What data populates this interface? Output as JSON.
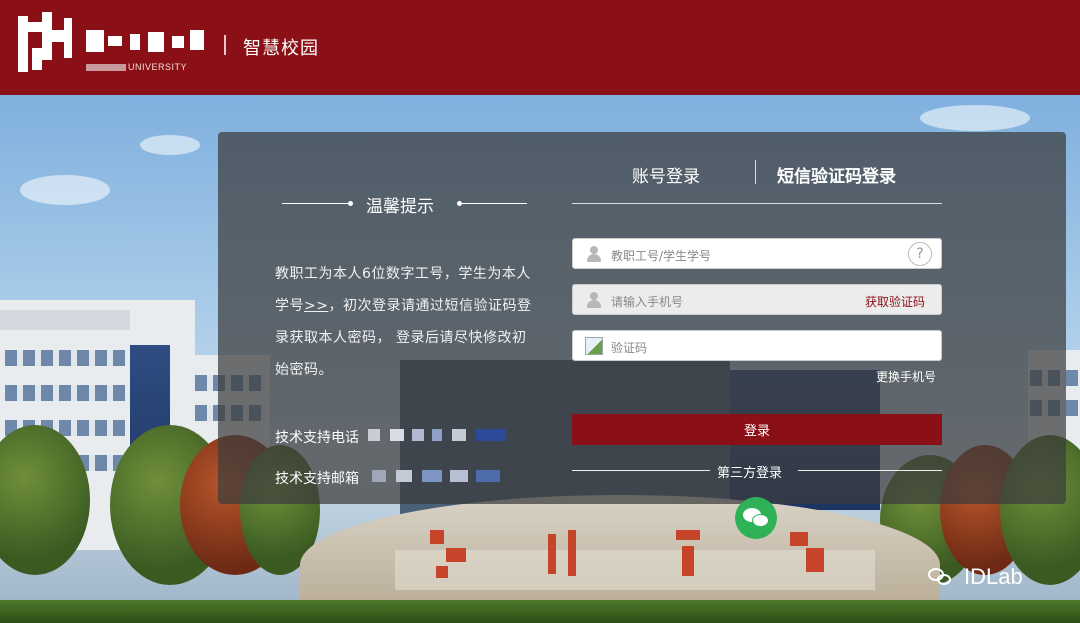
{
  "header": {
    "logo_sub": "UNIVERSITY",
    "site_title": "智慧校园"
  },
  "tips": {
    "title": "温馨提示",
    "text_before_link": "教职工为本人6位数字工号，学生为本人学号",
    "link": ">>",
    "text_after_link": "，初次登录请通过短信验证码登录获取本人密码， 登录后请尽快修改初始密码。",
    "support_phone_label": "技术支持电话",
    "support_email_label": "技术支持邮箱"
  },
  "tabs": [
    {
      "label": "账号登录",
      "active": false
    },
    {
      "label": "短信验证码登录",
      "active": true
    }
  ],
  "form": {
    "account_placeholder": "教职工号/学生学号",
    "phone_placeholder": "请输入手机号",
    "get_code_label": "获取验证码",
    "captcha_placeholder": "验证码",
    "change_phone_label": "更换手机号",
    "login_label": "登录",
    "help_label": "?"
  },
  "third_party": {
    "label": "第三方登录",
    "icon": "wechat-icon"
  },
  "watermark": {
    "text": "IDLab"
  },
  "colors": {
    "brand": "#8a0f17",
    "wechat": "#2fb157"
  }
}
